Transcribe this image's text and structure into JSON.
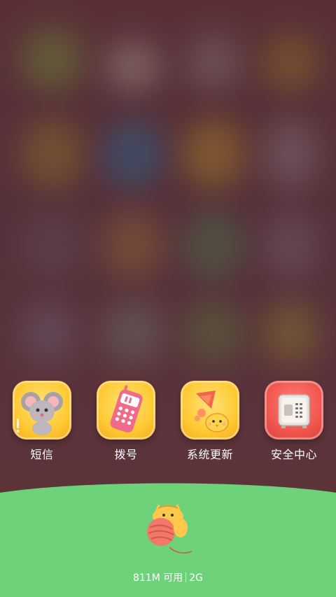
{
  "apps": [
    {
      "id": "sms",
      "label": "短信",
      "icon": "mouse-sticker-icon"
    },
    {
      "id": "dialer",
      "label": "拨号",
      "icon": "pink-phone-icon"
    },
    {
      "id": "system-update",
      "label": "系统更新",
      "icon": "rocket-chick-icon"
    },
    {
      "id": "security-center",
      "label": "安全中心",
      "icon": "safe-icon"
    }
  ],
  "memory": {
    "available": "811M 可用",
    "total": "2G"
  },
  "colors": {
    "background": "#5a2f37",
    "panel_green": "#6dd27a",
    "tile_yellow": "#ffca3a",
    "tile_red": "#f0564e"
  }
}
